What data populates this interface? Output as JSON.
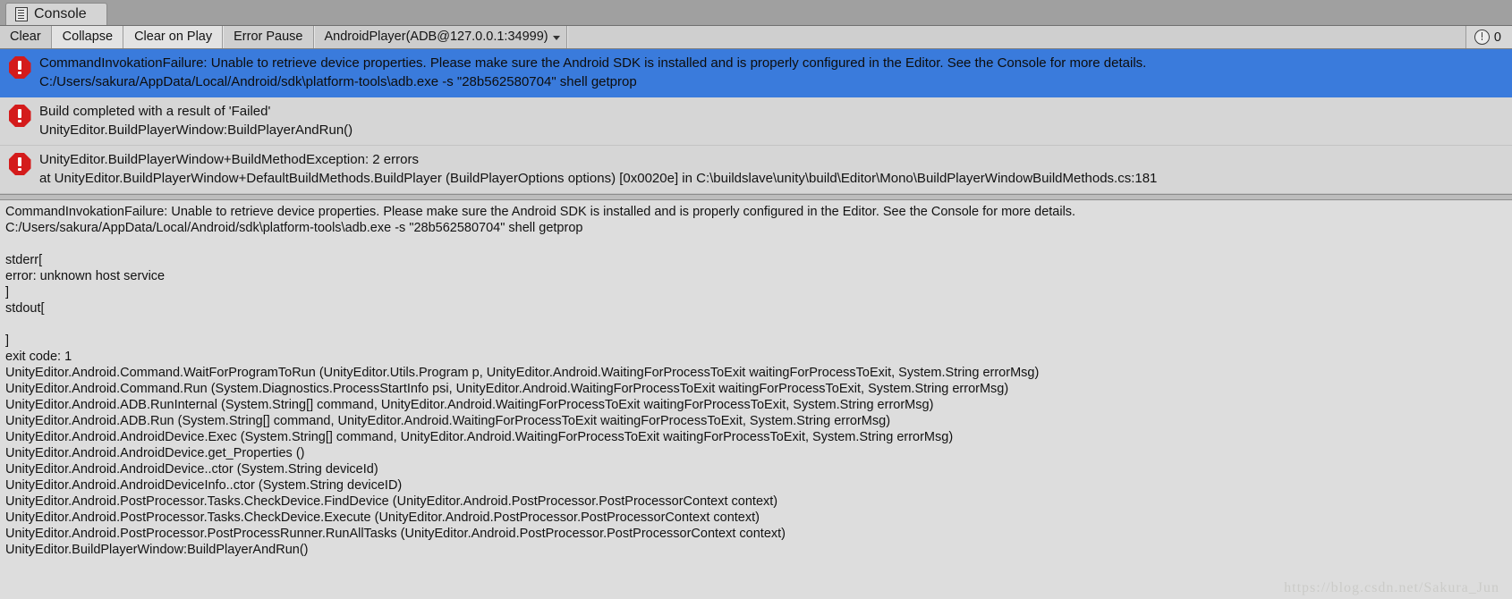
{
  "window": {
    "tab_label": "Console",
    "tab_icon": "console-icon"
  },
  "toolbar": {
    "clear_label": "Clear",
    "collapse_label": "Collapse",
    "clear_on_play_label": "Clear on Play",
    "error_pause_label": "Error Pause",
    "connection_label": "AndroidPlayer(ADB@127.0.0.1:34999)",
    "warning_count": "0",
    "warning_icon": "warning-circle-icon",
    "caret_icon": "chevron-down-icon"
  },
  "log_list": {
    "entries": [
      {
        "icon": "error-icon",
        "selected": true,
        "line1": "CommandInvokationFailure: Unable to retrieve device properties. Please make sure the Android SDK is installed and is properly configured in the Editor. See the Console for more details.",
        "line2": "C:/Users/sakura/AppData/Local/Android/sdk\\platform-tools\\adb.exe -s \"28b562580704\" shell getprop"
      },
      {
        "icon": "error-icon",
        "selected": false,
        "line1": "Build completed with a result of 'Failed'",
        "line2": "UnityEditor.BuildPlayerWindow:BuildPlayerAndRun()"
      },
      {
        "icon": "error-icon",
        "selected": false,
        "line1": "UnityEditor.BuildPlayerWindow+BuildMethodException: 2 errors",
        "line2": "  at UnityEditor.BuildPlayerWindow+DefaultBuildMethods.BuildPlayer (BuildPlayerOptions options) [0x0020e] in C:\\buildslave\\unity\\build\\Editor\\Mono\\BuildPlayerWindowBuildMethods.cs:181"
      }
    ]
  },
  "detail": {
    "lines": [
      "CommandInvokationFailure: Unable to retrieve device properties. Please make sure the Android SDK is installed and is properly configured in the Editor. See the Console for more details.",
      "C:/Users/sakura/AppData/Local/Android/sdk\\platform-tools\\adb.exe -s \"28b562580704\" shell getprop",
      "",
      "stderr[",
      "error: unknown host service",
      "]",
      "stdout[",
      "",
      "]",
      "exit code: 1",
      "UnityEditor.Android.Command.WaitForProgramToRun (UnityEditor.Utils.Program p, UnityEditor.Android.WaitingForProcessToExit waitingForProcessToExit, System.String errorMsg)",
      "UnityEditor.Android.Command.Run (System.Diagnostics.ProcessStartInfo psi, UnityEditor.Android.WaitingForProcessToExit waitingForProcessToExit, System.String errorMsg)",
      "UnityEditor.Android.ADB.RunInternal (System.String[] command, UnityEditor.Android.WaitingForProcessToExit waitingForProcessToExit, System.String errorMsg)",
      "UnityEditor.Android.ADB.Run (System.String[] command, UnityEditor.Android.WaitingForProcessToExit waitingForProcessToExit, System.String errorMsg)",
      "UnityEditor.Android.AndroidDevice.Exec (System.String[] command, UnityEditor.Android.WaitingForProcessToExit waitingForProcessToExit, System.String errorMsg)",
      "UnityEditor.Android.AndroidDevice.get_Properties ()",
      "UnityEditor.Android.AndroidDevice..ctor (System.String deviceId)",
      "UnityEditor.Android.AndroidDeviceInfo..ctor (System.String deviceID)",
      "UnityEditor.Android.PostProcessor.Tasks.CheckDevice.FindDevice (UnityEditor.Android.PostProcessor.PostProcessorContext context)",
      "UnityEditor.Android.PostProcessor.Tasks.CheckDevice.Execute (UnityEditor.Android.PostProcessor.PostProcessorContext context)",
      "UnityEditor.Android.PostProcessor.PostProcessRunner.RunAllTasks (UnityEditor.Android.PostProcessor.PostProcessorContext context)",
      "UnityEditor.BuildPlayerWindow:BuildPlayerAndRun()"
    ]
  },
  "watermark": {
    "text": "https://blog.csdn.net/Sakura_Jun"
  },
  "colors": {
    "selection_blue": "#3a7bdc",
    "error_red": "#d41b1b",
    "panel_gray": "#dddddd",
    "list_gray": "#d6d6d6",
    "toolbar_gray": "#c4c4c4",
    "tabbar_gray": "#a0a0a0"
  }
}
